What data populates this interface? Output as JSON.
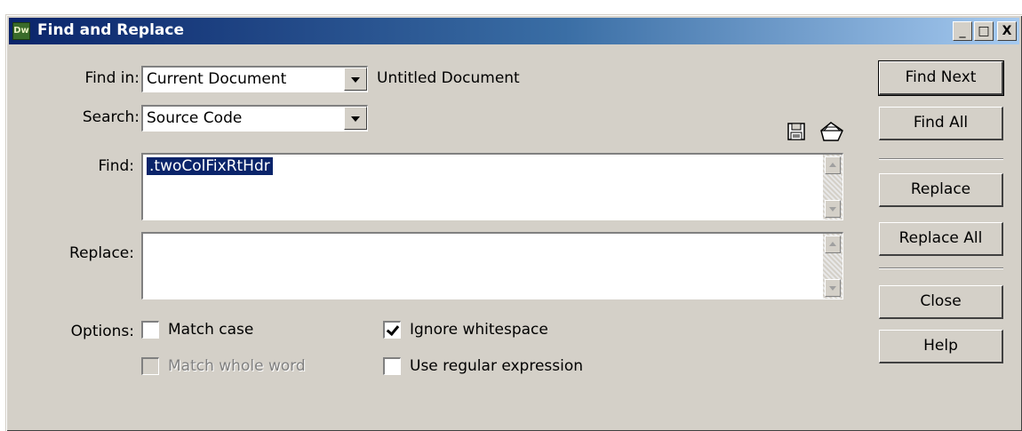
{
  "window": {
    "app_icon_text": "Dw",
    "title": "Find and Replace",
    "controls": {
      "minimize": "_",
      "maximize": "□",
      "close": "X"
    }
  },
  "find_in": {
    "label": "Find in:",
    "value": "Current Document",
    "document_name": "Untitled Document"
  },
  "search": {
    "label": "Search:",
    "value": "Source Code"
  },
  "find": {
    "label": "Find:",
    "value": ".twoColFixRtHdr"
  },
  "replace": {
    "label": "Replace:",
    "value": ""
  },
  "options": {
    "label": "Options:",
    "match_case": {
      "label": "Match case",
      "checked": false
    },
    "match_whole_word": {
      "label": "Match whole word",
      "checked": false,
      "disabled": true
    },
    "ignore_whitespace": {
      "label": "Ignore whitespace",
      "checked": true
    },
    "use_regex": {
      "label": "Use regular expression",
      "checked": false
    }
  },
  "buttons": {
    "find_next": "Find Next",
    "find_all": "Find All",
    "replace": "Replace",
    "replace_all": "Replace All",
    "close": "Close",
    "help": "Help"
  },
  "icons": {
    "save": "save-query-icon",
    "load": "load-query-icon"
  }
}
